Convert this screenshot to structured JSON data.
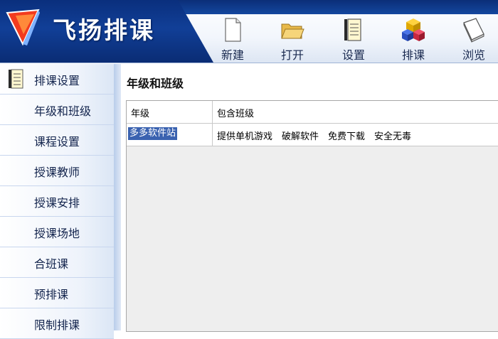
{
  "app": {
    "title": "飞扬排课"
  },
  "toolbar": {
    "buttons": [
      {
        "label": "新建",
        "icon": "new-file-icon"
      },
      {
        "label": "打开",
        "icon": "folder-open-icon"
      },
      {
        "label": "设置",
        "icon": "settings-document-icon"
      },
      {
        "label": "排课",
        "icon": "blocks-icon"
      },
      {
        "label": "浏览",
        "icon": "book-icon"
      }
    ]
  },
  "sidebar": {
    "items": [
      {
        "label": "排课设置",
        "icon": "notebook-icon"
      },
      {
        "label": "年级和班级"
      },
      {
        "label": "课程设置"
      },
      {
        "label": "授课教师"
      },
      {
        "label": "授课安排"
      },
      {
        "label": "授课场地"
      },
      {
        "label": "合班课"
      },
      {
        "label": "预排课"
      },
      {
        "label": "限制排课"
      }
    ]
  },
  "main": {
    "title": "年级和班级",
    "table": {
      "headers": [
        "年级",
        "包含班级"
      ],
      "rows": [
        [
          "多多软件站",
          "提供单机游戏　破解软件　免费下载　安全无毒"
        ]
      ]
    }
  },
  "colors": {
    "banner": "#0a2f7d",
    "selection": "#3a62b0",
    "sidebar": "#eef3fb"
  }
}
